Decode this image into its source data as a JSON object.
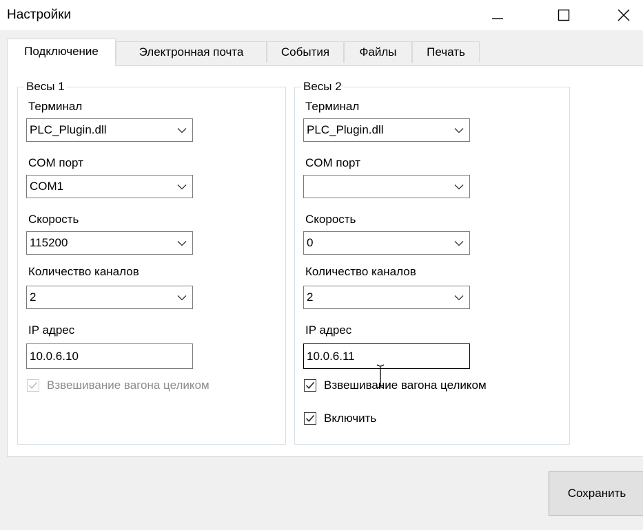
{
  "window": {
    "title": "Настройки"
  },
  "tabs": [
    {
      "label": "Подключение",
      "active": true
    },
    {
      "label": "Электронная почта",
      "active": false
    },
    {
      "label": "События",
      "active": false
    },
    {
      "label": "Файлы",
      "active": false
    },
    {
      "label": "Печать",
      "active": false
    }
  ],
  "scale1": {
    "title": "Весы 1",
    "terminal_label": "Терминал",
    "terminal_value": "PLC_Plugin.dll",
    "com_label": "COM порт",
    "com_value": "COM1",
    "speed_label": "Скорость",
    "speed_value": "115200",
    "channels_label": "Количество каналов",
    "channels_value": "2",
    "ip_label": "IP адрес",
    "ip_value": "10.0.6.10",
    "weigh_whole_label": "Взвешивание вагона целиком",
    "weigh_whole_checked": true,
    "weigh_whole_enabled": false
  },
  "scale2": {
    "title": "Весы 2",
    "terminal_label": "Терминал",
    "terminal_value": "PLC_Plugin.dll",
    "com_label": "COM порт",
    "com_value": "",
    "speed_label": "Скорость",
    "speed_value": "0",
    "channels_label": "Количество каналов",
    "channels_value": "2",
    "ip_label": "IP адрес",
    "ip_value": "10.0.6.11",
    "weigh_whole_label": "Взвешивание вагона целиком",
    "weigh_whole_checked": true,
    "enable_label": "Включить",
    "enable_checked": true
  },
  "footer": {
    "save_label": "Сохранить"
  }
}
